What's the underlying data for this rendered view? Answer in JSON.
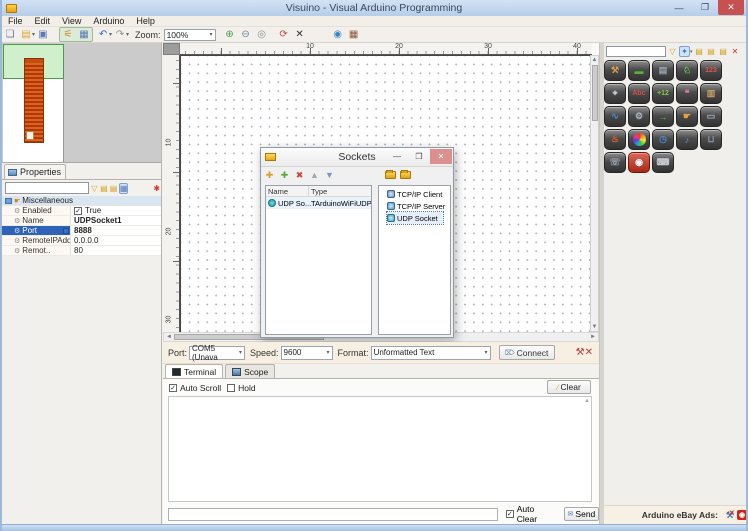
{
  "window": {
    "title": "Visuino - Visual Arduino Programming"
  },
  "menu": {
    "items": [
      "File",
      "Edit",
      "View",
      "Arduino",
      "Help"
    ]
  },
  "toolbar": {
    "zoom_label": "Zoom:",
    "zoom_value": "100%"
  },
  "properties_panel": {
    "tab_label": "Properties",
    "search_value": "",
    "rows": [
      {
        "key": "miscellaneous",
        "label": "Miscellaneous",
        "type": "category"
      },
      {
        "key": "enabled",
        "label": "Enabled",
        "value": "True",
        "checkbox": true
      },
      {
        "key": "name",
        "label": "Name",
        "value": "UDPSocket1",
        "bold": true
      },
      {
        "key": "port",
        "label": "Port",
        "value": "8888",
        "bold": true,
        "selected": true
      },
      {
        "key": "remote-ip",
        "label": "RemoteIPAdd..",
        "value": "0.0.0.0"
      },
      {
        "key": "remote-port",
        "label": "Remot..",
        "value": "80"
      }
    ]
  },
  "canvas": {
    "ruler_h": [
      "10",
      "20",
      "30",
      "40"
    ],
    "ruler_v": [
      "10",
      "20",
      "30"
    ]
  },
  "sockets_dialog": {
    "title": "Sockets",
    "columns": {
      "name": "Name",
      "type": "Type"
    },
    "list": [
      {
        "name": "UDP So...",
        "type": "TArduinoWiFiUDPSocket"
      }
    ],
    "tree": [
      {
        "label": "TCP/IP Client",
        "selected": false
      },
      {
        "label": "TCP/IP Server",
        "selected": false
      },
      {
        "label": "UDP Socket",
        "selected": true
      }
    ]
  },
  "serial_bar": {
    "port_label": "Port:",
    "port_value": "COM5 (Unava",
    "speed_label": "Speed:",
    "speed_value": "9600",
    "format_label": "Format:",
    "format_value": "Unformatted Text",
    "connect_label": "Connect"
  },
  "terminal_panel": {
    "tabs": [
      {
        "label": "Terminal",
        "active": true
      },
      {
        "label": "Scope",
        "active": false
      }
    ],
    "auto_scroll_label": "Auto Scroll",
    "hold_label": "Hold",
    "clear_label": "Clear",
    "auto_clear_label": "Auto Clear",
    "send_label": "Send",
    "input_value": ""
  },
  "palette": {
    "icons": [
      {
        "name": "tools",
        "glyph": "⚒",
        "color": "#d9a44a"
      },
      {
        "name": "arduino-boards",
        "glyph": "▬",
        "color": "#58b038"
      },
      {
        "name": "shields",
        "glyph": "▤",
        "color": "#9aa4ae"
      },
      {
        "name": "robotics",
        "glyph": "♘",
        "color": "#5ec04e"
      },
      {
        "name": "digits",
        "glyph": "123",
        "color": "#e05548"
      },
      {
        "name": "mouse",
        "glyph": "⌖",
        "color": "#cfd6dd"
      },
      {
        "name": "text",
        "glyph": "Abc",
        "color": "#d84f40"
      },
      {
        "name": "math",
        "glyph": "+12",
        "color": "#7ec84a"
      },
      {
        "name": "communication",
        "glyph": "❝",
        "color": "#e873a8"
      },
      {
        "name": "memory",
        "glyph": "▥",
        "color": "#c8a064"
      },
      {
        "name": "analog",
        "glyph": "∿",
        "color": "#4a86d8"
      },
      {
        "name": "generators",
        "glyph": "⚙",
        "color": "#b0b8c0"
      },
      {
        "name": "converters",
        "glyph": "→",
        "color": "#6cc040"
      },
      {
        "name": "buttons",
        "glyph": "☛",
        "color": "#e8a040"
      },
      {
        "name": "displays",
        "glyph": "▭",
        "color": "#9ab0c8"
      },
      {
        "name": "heat",
        "glyph": "♨",
        "color": "#e86020"
      },
      {
        "name": "color",
        "glyph": "",
        "color": ""
      },
      {
        "name": "time",
        "glyph": "◷",
        "color": "#4a86d8"
      },
      {
        "name": "audio",
        "glyph": "♪",
        "color": "#5a9ad8"
      },
      {
        "name": "plumbing",
        "glyph": "⊔",
        "color": "#8a98a8"
      },
      {
        "name": "speech",
        "glyph": "☏",
        "color": "#9aa4b0"
      },
      {
        "name": "power",
        "glyph": "◉",
        "color": "#ffffff"
      },
      {
        "name": "keyboard",
        "glyph": "⌨",
        "color": "#c8ccd0"
      }
    ]
  },
  "ads": {
    "label": "Arduino eBay Ads:"
  }
}
